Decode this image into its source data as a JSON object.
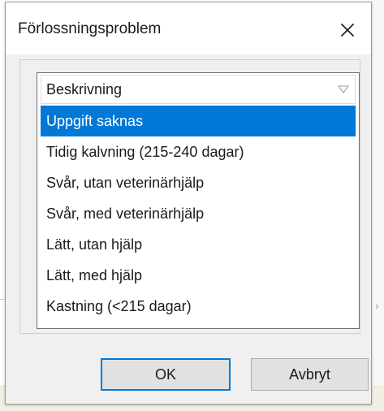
{
  "window": {
    "title": "Förlossningsproblem",
    "close_icon": "close-icon"
  },
  "list": {
    "header": "Beskrivning",
    "sort_icon": "sort-down-triangle-icon",
    "items": [
      "Uppgift saknas",
      "Tidig kalvning (215-240 dagar)",
      "Svår, utan veterinärhjälp",
      "Svår, med veterinärhjälp",
      "Lätt, utan hjälp",
      "Lätt, med hjälp",
      "Kastning (<215 dagar)"
    ],
    "selected_index": 0
  },
  "buttons": {
    "ok": "OK",
    "cancel": "Avbryt"
  },
  "colors": {
    "selection": "#0078d7",
    "dialog_bg": "#f0f0f0",
    "default_button_border": "#0078d7"
  }
}
